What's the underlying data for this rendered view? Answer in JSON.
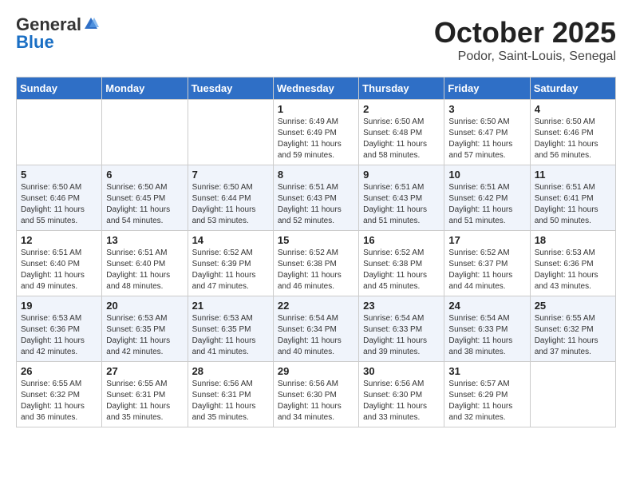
{
  "logo": {
    "general": "General",
    "blue": "Blue"
  },
  "header": {
    "month": "October 2025",
    "location": "Podor, Saint-Louis, Senegal"
  },
  "weekdays": [
    "Sunday",
    "Monday",
    "Tuesday",
    "Wednesday",
    "Thursday",
    "Friday",
    "Saturday"
  ],
  "weeks": [
    [
      {
        "day": "",
        "info": ""
      },
      {
        "day": "",
        "info": ""
      },
      {
        "day": "",
        "info": ""
      },
      {
        "day": "1",
        "info": "Sunrise: 6:49 AM\nSunset: 6:49 PM\nDaylight: 11 hours and 59 minutes."
      },
      {
        "day": "2",
        "info": "Sunrise: 6:50 AM\nSunset: 6:48 PM\nDaylight: 11 hours and 58 minutes."
      },
      {
        "day": "3",
        "info": "Sunrise: 6:50 AM\nSunset: 6:47 PM\nDaylight: 11 hours and 57 minutes."
      },
      {
        "day": "4",
        "info": "Sunrise: 6:50 AM\nSunset: 6:46 PM\nDaylight: 11 hours and 56 minutes."
      }
    ],
    [
      {
        "day": "5",
        "info": "Sunrise: 6:50 AM\nSunset: 6:46 PM\nDaylight: 11 hours and 55 minutes."
      },
      {
        "day": "6",
        "info": "Sunrise: 6:50 AM\nSunset: 6:45 PM\nDaylight: 11 hours and 54 minutes."
      },
      {
        "day": "7",
        "info": "Sunrise: 6:50 AM\nSunset: 6:44 PM\nDaylight: 11 hours and 53 minutes."
      },
      {
        "day": "8",
        "info": "Sunrise: 6:51 AM\nSunset: 6:43 PM\nDaylight: 11 hours and 52 minutes."
      },
      {
        "day": "9",
        "info": "Sunrise: 6:51 AM\nSunset: 6:43 PM\nDaylight: 11 hours and 51 minutes."
      },
      {
        "day": "10",
        "info": "Sunrise: 6:51 AM\nSunset: 6:42 PM\nDaylight: 11 hours and 51 minutes."
      },
      {
        "day": "11",
        "info": "Sunrise: 6:51 AM\nSunset: 6:41 PM\nDaylight: 11 hours and 50 minutes."
      }
    ],
    [
      {
        "day": "12",
        "info": "Sunrise: 6:51 AM\nSunset: 6:40 PM\nDaylight: 11 hours and 49 minutes."
      },
      {
        "day": "13",
        "info": "Sunrise: 6:51 AM\nSunset: 6:40 PM\nDaylight: 11 hours and 48 minutes."
      },
      {
        "day": "14",
        "info": "Sunrise: 6:52 AM\nSunset: 6:39 PM\nDaylight: 11 hours and 47 minutes."
      },
      {
        "day": "15",
        "info": "Sunrise: 6:52 AM\nSunset: 6:38 PM\nDaylight: 11 hours and 46 minutes."
      },
      {
        "day": "16",
        "info": "Sunrise: 6:52 AM\nSunset: 6:38 PM\nDaylight: 11 hours and 45 minutes."
      },
      {
        "day": "17",
        "info": "Sunrise: 6:52 AM\nSunset: 6:37 PM\nDaylight: 11 hours and 44 minutes."
      },
      {
        "day": "18",
        "info": "Sunrise: 6:53 AM\nSunset: 6:36 PM\nDaylight: 11 hours and 43 minutes."
      }
    ],
    [
      {
        "day": "19",
        "info": "Sunrise: 6:53 AM\nSunset: 6:36 PM\nDaylight: 11 hours and 42 minutes."
      },
      {
        "day": "20",
        "info": "Sunrise: 6:53 AM\nSunset: 6:35 PM\nDaylight: 11 hours and 42 minutes."
      },
      {
        "day": "21",
        "info": "Sunrise: 6:53 AM\nSunset: 6:35 PM\nDaylight: 11 hours and 41 minutes."
      },
      {
        "day": "22",
        "info": "Sunrise: 6:54 AM\nSunset: 6:34 PM\nDaylight: 11 hours and 40 minutes."
      },
      {
        "day": "23",
        "info": "Sunrise: 6:54 AM\nSunset: 6:33 PM\nDaylight: 11 hours and 39 minutes."
      },
      {
        "day": "24",
        "info": "Sunrise: 6:54 AM\nSunset: 6:33 PM\nDaylight: 11 hours and 38 minutes."
      },
      {
        "day": "25",
        "info": "Sunrise: 6:55 AM\nSunset: 6:32 PM\nDaylight: 11 hours and 37 minutes."
      }
    ],
    [
      {
        "day": "26",
        "info": "Sunrise: 6:55 AM\nSunset: 6:32 PM\nDaylight: 11 hours and 36 minutes."
      },
      {
        "day": "27",
        "info": "Sunrise: 6:55 AM\nSunset: 6:31 PM\nDaylight: 11 hours and 35 minutes."
      },
      {
        "day": "28",
        "info": "Sunrise: 6:56 AM\nSunset: 6:31 PM\nDaylight: 11 hours and 35 minutes."
      },
      {
        "day": "29",
        "info": "Sunrise: 6:56 AM\nSunset: 6:30 PM\nDaylight: 11 hours and 34 minutes."
      },
      {
        "day": "30",
        "info": "Sunrise: 6:56 AM\nSunset: 6:30 PM\nDaylight: 11 hours and 33 minutes."
      },
      {
        "day": "31",
        "info": "Sunrise: 6:57 AM\nSunset: 6:29 PM\nDaylight: 11 hours and 32 minutes."
      },
      {
        "day": "",
        "info": ""
      }
    ]
  ]
}
